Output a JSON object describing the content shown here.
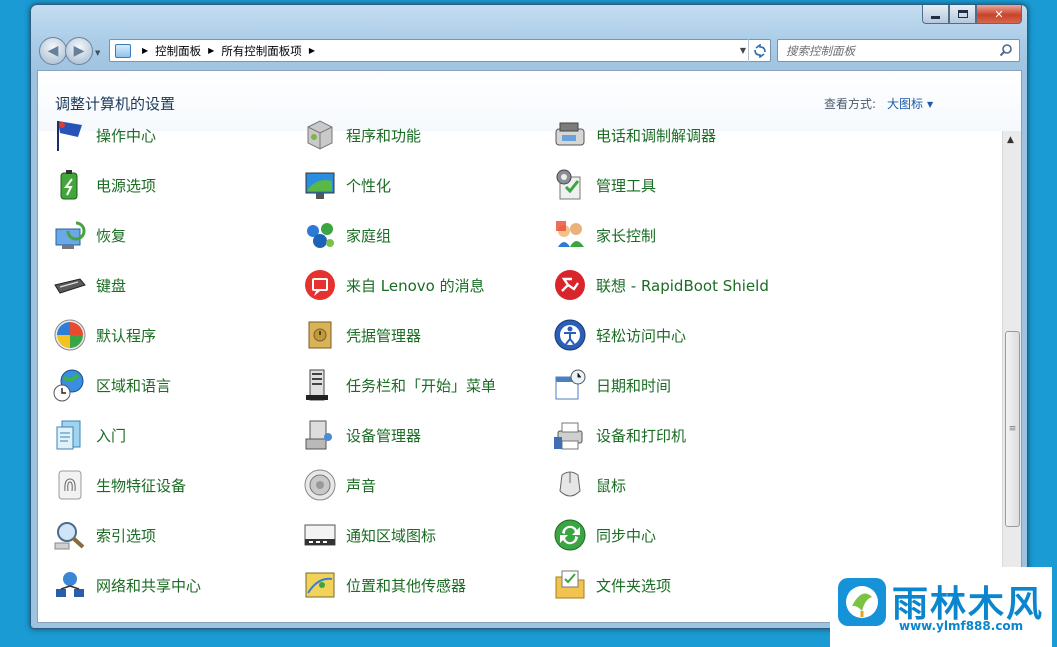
{
  "window": {
    "minimize_label": "minimize",
    "maximize_label": "maximize",
    "close_label": "✕"
  },
  "address_bar": {
    "crumbs": [
      "控制面板",
      "所有控制面板项"
    ]
  },
  "search": {
    "placeholder": "搜索控制面板"
  },
  "header": {
    "title": "调整计算机的设置",
    "view_label": "查看方式:",
    "view_value": "大图标"
  },
  "items": [
    {
      "label": "操作中心",
      "icon": "action-center-flag-icon"
    },
    {
      "label": "电源选项",
      "icon": "power-battery-icon"
    },
    {
      "label": "恢复",
      "icon": "recovery-icon"
    },
    {
      "label": "键盘",
      "icon": "keyboard-icon"
    },
    {
      "label": "默认程序",
      "icon": "default-programs-icon"
    },
    {
      "label": "区域和语言",
      "icon": "globe-clock-icon"
    },
    {
      "label": "入门",
      "icon": "getting-started-icon"
    },
    {
      "label": "生物特征设备",
      "icon": "fingerprint-icon"
    },
    {
      "label": "索引选项",
      "icon": "indexing-magnifier-icon"
    },
    {
      "label": "网络和共享中心",
      "icon": "network-icon"
    },
    {
      "label": "程序和功能",
      "icon": "programs-box-icon"
    },
    {
      "label": "个性化",
      "icon": "personalization-monitor-icon"
    },
    {
      "label": "家庭组",
      "icon": "homegroup-icon"
    },
    {
      "label": "来自 Lenovo 的消息",
      "icon": "lenovo-message-icon"
    },
    {
      "label": "凭据管理器",
      "icon": "credential-safe-icon"
    },
    {
      "label": "任务栏和「开始」菜单",
      "icon": "taskbar-icon"
    },
    {
      "label": "设备管理器",
      "icon": "device-manager-icon"
    },
    {
      "label": "声音",
      "icon": "speaker-icon"
    },
    {
      "label": "通知区域图标",
      "icon": "notification-area-icon"
    },
    {
      "label": "位置和其他传感器",
      "icon": "location-sensor-icon"
    },
    {
      "label": "电话和调制解调器",
      "icon": "phone-modem-icon"
    },
    {
      "label": "管理工具",
      "icon": "admin-tools-icon"
    },
    {
      "label": "家长控制",
      "icon": "parental-controls-icon"
    },
    {
      "label": "联想 - RapidBoot Shield",
      "icon": "rapidboot-shield-icon"
    },
    {
      "label": "轻松访问中心",
      "icon": "ease-of-access-icon"
    },
    {
      "label": "日期和时间",
      "icon": "date-time-icon"
    },
    {
      "label": "设备和打印机",
      "icon": "devices-printers-icon"
    },
    {
      "label": "鼠标",
      "icon": "mouse-icon"
    },
    {
      "label": "同步中心",
      "icon": "sync-center-icon"
    },
    {
      "label": "文件夹选项",
      "icon": "folder-options-icon"
    }
  ],
  "watermark": {
    "title": "雨林木风",
    "url": "www.ylmf888.com"
  }
}
